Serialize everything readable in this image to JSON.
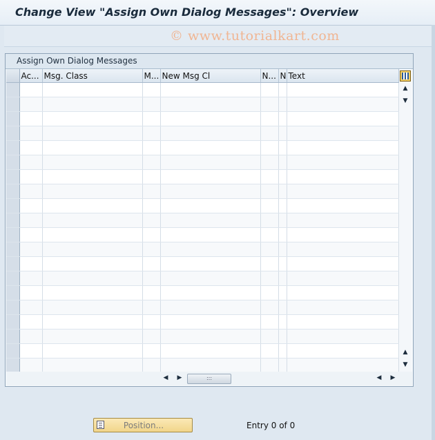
{
  "window": {
    "title": "Change View \"Assign Own Dialog Messages\": Overview"
  },
  "watermark": "© www.tutorialkart.com",
  "table": {
    "title": "Assign Own Dialog Messages",
    "columns": [
      "Ac...",
      "Msg. Class",
      "M...",
      "New Msg Cl",
      "N...",
      "N",
      "Text"
    ],
    "row_count": 20,
    "rows": []
  },
  "footer": {
    "position_button": "Position...",
    "entry_info": "Entry 0 of 0"
  },
  "icons": {
    "scroll_up": "▲",
    "scroll_down": "▼",
    "scroll_left": "◀",
    "scroll_right": "▶",
    "thumb_grip": ":::"
  }
}
